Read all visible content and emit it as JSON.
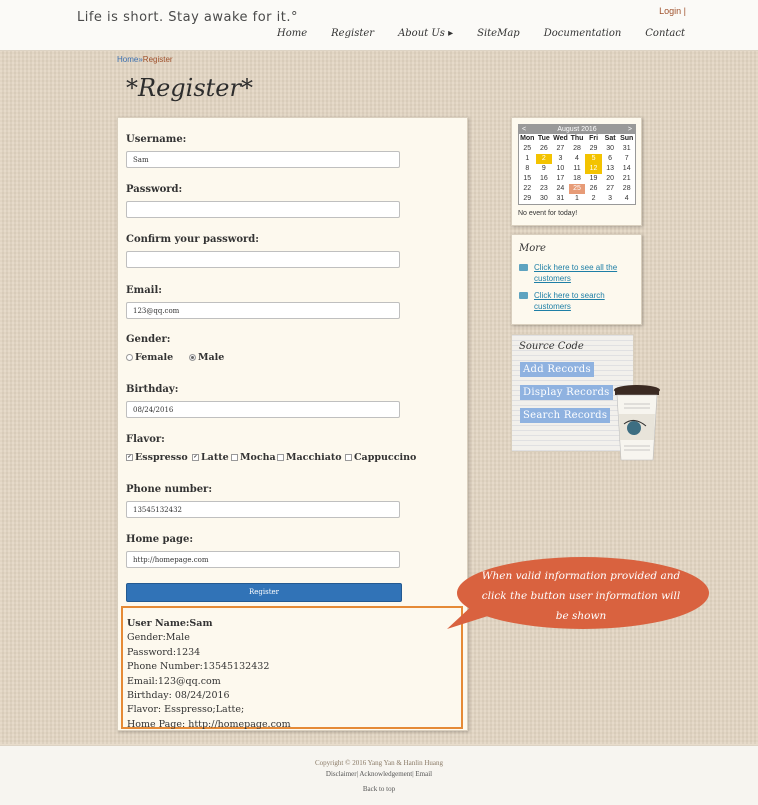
{
  "header": {
    "tagline": "Life is short. Stay awake for it.°",
    "login": "Login |",
    "nav": [
      "Home",
      "Register",
      "About Us ▸",
      "SiteMap",
      "Documentation",
      "Contact"
    ]
  },
  "breadcrumb": {
    "home": "Home",
    "sep": "»",
    "current": "Register"
  },
  "page_title": "*Register*",
  "form": {
    "username_label": "Username:",
    "username_value": "Sam",
    "password_label": "Password:",
    "password_value": "",
    "confirm_label": "Confirm your password:",
    "confirm_value": "",
    "email_label": "Email:",
    "email_value": "123@qq.com",
    "gender_label": "Gender:",
    "gender_options": [
      "Female",
      "Male"
    ],
    "gender_selected": "Male",
    "birthday_label": "Birthday:",
    "birthday_value": "08/24/2016",
    "flavor_label": "Flavor:",
    "flavor_options": [
      "Esspresso",
      "Latte",
      "Mocha",
      "Macchiato",
      "Cappuccino"
    ],
    "flavor_checked": [
      "Esspresso",
      "Latte"
    ],
    "phone_label": "Phone number:",
    "phone_value": "13545132432",
    "homepage_label": "Home page:",
    "homepage_value": "http://homepage.com",
    "submit_label": "Register"
  },
  "result": {
    "lines": [
      "User Name:Sam",
      "Gender:Male",
      "Password:1234",
      "Phone Number:13545132432",
      "Email:123@qq.com",
      "Birthday: 08/24/2016",
      "Flavor: Esspresso;Latte;",
      "Home Page:   http://homepage.com"
    ]
  },
  "calendar": {
    "month": "August 2016",
    "prev": "<",
    "next": ">",
    "weekdays": [
      "Mon",
      "Tue",
      "Wed",
      "Thu",
      "Fri",
      "Sat",
      "Sun"
    ],
    "days": [
      "25",
      "26",
      "27",
      "28",
      "29",
      "30",
      "31",
      "1",
      "2",
      "3",
      "4",
      "5",
      "6",
      "7",
      "8",
      "9",
      "10",
      "11",
      "12",
      "13",
      "14",
      "15",
      "16",
      "17",
      "18",
      "19",
      "20",
      "21",
      "22",
      "23",
      "24",
      "25",
      "26",
      "27",
      "28",
      "29",
      "30",
      "31",
      "1",
      "2",
      "3",
      "4"
    ],
    "event_days": [
      "2",
      "5",
      "12"
    ],
    "today": "25",
    "no_event": "No event for today!"
  },
  "more": {
    "title": "More",
    "links": [
      "Click here to see all the customers",
      "Click here to search customers"
    ]
  },
  "source_code": {
    "title": "Source Code",
    "buttons": [
      "Add Records",
      "Display Records",
      "Search Records"
    ]
  },
  "callout": {
    "text": "When valid information provided and click the button user information will be shown"
  },
  "footer": {
    "copyright": "Copyright © 2016 Yang Yan & Hanlin Huang",
    "links": "Disclaimer| Acknowledgement| Email",
    "back_to_top": "Back to top"
  },
  "colors": {
    "accent": "#3173b7",
    "highlight_border": "#e58a36",
    "callout": "#d9623f",
    "event_day": "#f3c300",
    "today": "#e79b77"
  }
}
